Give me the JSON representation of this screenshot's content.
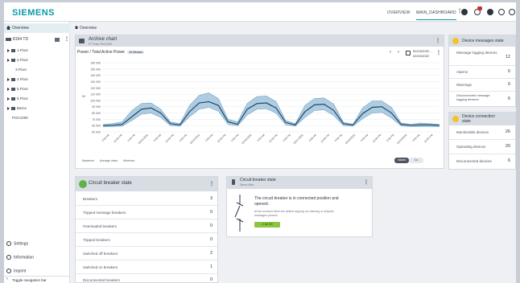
{
  "topbar": {
    "logo": "SIEMENS",
    "nav": [
      "OVERVIEW",
      "MAIN_DASHBOARD"
    ],
    "notification_badge": "10"
  },
  "sidebar": {
    "overview": "Overview",
    "tree_root": "8194 TD",
    "floors": [
      "1.Floor",
      "2.Floor",
      "3.Floor",
      "4.Floor",
      "5.Floor",
      "6.Floor",
      "Barns",
      "POC1000"
    ],
    "bottom": [
      "Settings",
      "Information",
      "Imprint"
    ],
    "toggle": "Toggle navigation bar"
  },
  "breadcrumb": "Overview",
  "archive": {
    "title": "Archive chart",
    "subtitle": "PT Trafo PAC4200",
    "measure": "Power / Total Active Power",
    "interval": "15 Minutes",
    "date_from": "02/13/2022 -",
    "date_to": "02/19/2022",
    "legend": [
      "Maximum",
      "Average value",
      "Minimum"
    ],
    "view_buttons": [
      "Values",
      "Ca"
    ]
  },
  "device_messages": {
    "title": "Device messages state",
    "rows": [
      {
        "label": "Message logging devices",
        "value": "12"
      },
      {
        "label": "Alarms",
        "value": "0"
      },
      {
        "label": "Warnings",
        "value": "0"
      },
      {
        "label": "Disconnected message logging devices",
        "value": "6"
      }
    ]
  },
  "device_connection": {
    "title": "Device connection state",
    "rows": [
      {
        "label": "Monitorable devices",
        "value": "26"
      },
      {
        "label": "Operating devices",
        "value": "20"
      },
      {
        "label": "Disconnected devices",
        "value": "6"
      }
    ]
  },
  "circuit_breaker": {
    "title": "Circuit breaker state",
    "rows": [
      {
        "label": "Breakers",
        "value": "3"
      },
      {
        "label": "Tripped message breakers",
        "value": "0"
      },
      {
        "label": "Overloaded breakers",
        "value": "0"
      },
      {
        "label": "Tripped breakers",
        "value": "0"
      },
      {
        "label": "Switched off breakers",
        "value": "2"
      },
      {
        "label": "Switched on breakers",
        "value": "1"
      },
      {
        "label": "Disconnected breakers",
        "value": "0"
      }
    ]
  },
  "breaker_detail": {
    "title": "Circuit breaker state",
    "subtitle": "Demo Wire",
    "status_line1": "The circuit breaker is in connected position and",
    "status_line2": "opened.",
    "note_line1": "At the moment there are neither tripping nor warning or setpoint",
    "note_line2": "messages present.",
    "ok_label": "All OK"
  },
  "colors": {
    "accent": "#0b9aa8",
    "warning": "#f2c230",
    "ok": "#5fb24a",
    "series_dark": "#1e4a6e",
    "series_band": "#8fb7d3"
  },
  "chart_data": {
    "type": "line",
    "title": "",
    "xlabel": "",
    "ylabel": "W",
    "ylim": [
      0,
      160000
    ],
    "y_ticks": [
      "160 000",
      "150 000",
      "140 000",
      "130 000",
      "120 000",
      "110 000",
      "100 000",
      "90 000",
      "80 000",
      "70 000",
      "60 000",
      "50 000"
    ],
    "x_ticks": [
      "6:00 AM",
      "12:00 PM",
      "6:00 PM",
      "02/14/2022",
      "6:00 AM",
      "12:00 PM",
      "6:00 PM",
      "02/15/2022",
      "6:00 AM",
      "12:00 PM",
      "6:00 PM",
      "02/16/2022",
      "6:00 AM",
      "12:00 PM",
      "6:00 PM",
      "02/17/2022",
      "6:00 AM",
      "12:00 PM",
      "6:00 PM",
      "02/18/2022",
      "6:00 AM",
      "12:00 PM",
      "6:00 PM",
      "02/19/2022",
      "6:00 AM",
      "12:00 PM"
    ],
    "series": [
      {
        "name": "Maximum",
        "values": [
          62000,
          63000,
          66000,
          84000,
          95000,
          96000,
          86000,
          66000,
          63000,
          92000,
          108000,
          112000,
          103000,
          70000,
          66000,
          95000,
          106000,
          107000,
          98000,
          68000,
          63000,
          92000,
          103000,
          104000,
          94000,
          65000,
          62000,
          88000,
          99000,
          99000,
          89000,
          64000,
          62000,
          64000,
          63000,
          62000
        ]
      },
      {
        "name": "Average value",
        "values": [
          60000,
          60500,
          62000,
          74000,
          86000,
          88000,
          80000,
          63000,
          61000,
          82000,
          96000,
          98000,
          92000,
          66000,
          62000,
          86000,
          95000,
          96000,
          88000,
          65000,
          61000,
          82000,
          93000,
          94000,
          84000,
          63000,
          61000,
          79000,
          89000,
          90000,
          80000,
          62000,
          60500,
          61000,
          61000,
          60500
        ]
      },
      {
        "name": "Minimum",
        "values": [
          58000,
          58500,
          59000,
          68000,
          78000,
          80000,
          73000,
          60000,
          59000,
          74000,
          86000,
          89000,
          83000,
          62000,
          59500,
          77000,
          86000,
          87000,
          80000,
          61000,
          59000,
          73000,
          84000,
          85000,
          76000,
          60000,
          59000,
          71000,
          80000,
          81000,
          72000,
          59500,
          58500,
          58500,
          58500,
          58000
        ]
      }
    ]
  }
}
